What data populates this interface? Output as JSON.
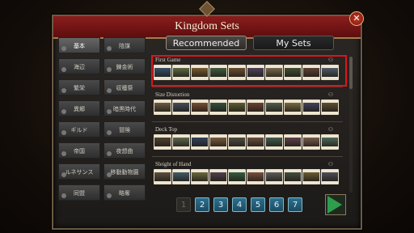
{
  "window": {
    "title": "Kingdom Sets",
    "close_glyph": "✕"
  },
  "tabs": [
    {
      "label": "Recommended",
      "active": true
    },
    {
      "label": "My Sets",
      "active": false
    }
  ],
  "sidebar": {
    "items": [
      {
        "label": "基本",
        "active": true
      },
      {
        "label": "陰謀",
        "active": false
      },
      {
        "label": "海辺",
        "active": false
      },
      {
        "label": "錬金術",
        "active": false
      },
      {
        "label": "繁栄",
        "active": false
      },
      {
        "label": "収穫祭",
        "active": false
      },
      {
        "label": "異郷",
        "active": false
      },
      {
        "label": "暗黒時代",
        "active": false
      },
      {
        "label": "ギルド",
        "active": false
      },
      {
        "label": "冒険",
        "active": false
      },
      {
        "label": "帝国",
        "active": false
      },
      {
        "label": "夜想曲",
        "active": false
      },
      {
        "label": "ルネサンス",
        "active": false
      },
      {
        "label": "移動動物園",
        "active": false
      },
      {
        "label": "同盟",
        "active": false
      },
      {
        "label": "略奪",
        "active": false
      }
    ]
  },
  "kingdom_sets": [
    {
      "name": "First Game",
      "selected": true,
      "icon": "people-icon"
    },
    {
      "name": "Size Distortion",
      "selected": false,
      "icon": "people-icon"
    },
    {
      "name": "Deck Top",
      "selected": false,
      "icon": "people-icon"
    },
    {
      "name": "Sleight of Hand",
      "selected": false,
      "icon": "people-icon"
    }
  ],
  "card_colors": [
    [
      "#3b5c7a",
      "#6a7a4a",
      "#8a6a3a",
      "#4a6a4a",
      "#7a5a3a",
      "#5a4a6a",
      "#8a7a5a",
      "#4a5a3a",
      "#6a4a3a",
      "#5a6a7a"
    ],
    [
      "#7a6a4a",
      "#4a5a6a",
      "#8a5a3a",
      "#3a5a4a",
      "#6a6a3a",
      "#7a4a3a",
      "#5a6a5a",
      "#8a7a4a",
      "#4a4a6a",
      "#6a5a3a"
    ],
    [
      "#5a4a3a",
      "#6a7a5a",
      "#3a4a6a",
      "#8a6a4a",
      "#5a5a4a",
      "#7a5a4a",
      "#4a6a5a",
      "#6a4a5a",
      "#8a6a5a",
      "#5a7a6a"
    ],
    [
      "#6a5a4a",
      "#4a6a7a",
      "#7a7a4a",
      "#5a4a5a",
      "#3a6a4a",
      "#8a5a4a",
      "#6a6a6a",
      "#4a5a4a",
      "#7a6a3a",
      "#5a5a6a"
    ]
  ],
  "pagination": {
    "pages": [
      "1",
      "2",
      "3",
      "4",
      "5",
      "6",
      "7"
    ],
    "current": "1"
  },
  "colors": {
    "title_bar": "#8b1d1d",
    "highlight": "#e0141b",
    "page_button": "#2d6f8b",
    "next_arrow": "#2f9c4e"
  }
}
